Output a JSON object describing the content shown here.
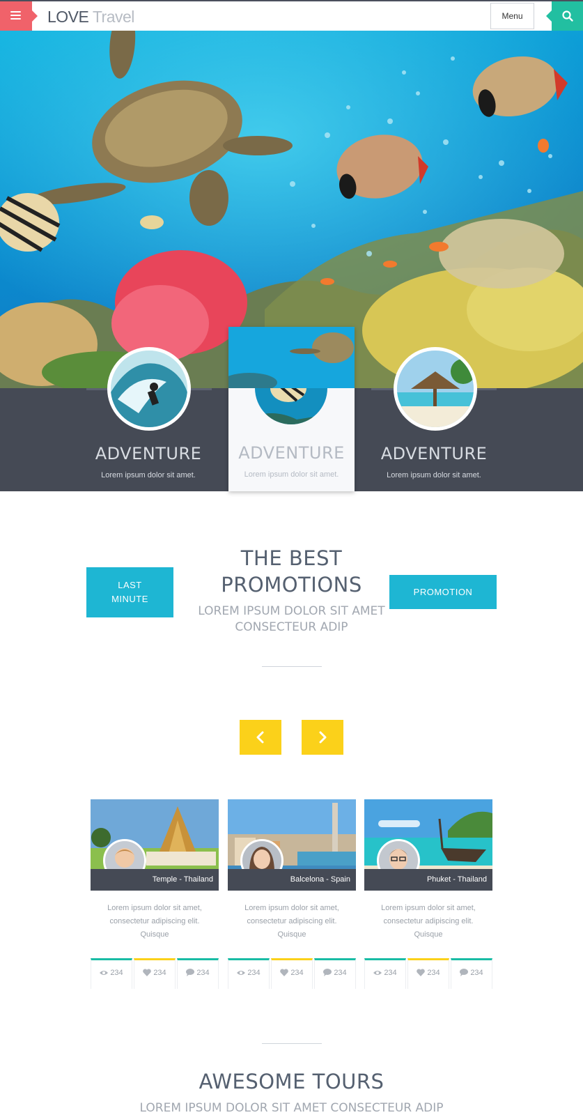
{
  "header": {
    "logo_part1": "LOVE",
    "logo_part2": "Travel",
    "menu_button": "Menu"
  },
  "categories": [
    {
      "title": "ADVENTURE",
      "subtitle": "Lorem ipsum dolor sit amet."
    },
    {
      "title": "ADVENTURE",
      "subtitle": "Lorem ipsum dolor sit amet."
    },
    {
      "title": "ADVENTURE",
      "subtitle": "Lorem ipsum dolor sit amet."
    }
  ],
  "promotions": {
    "title_line1": "THE BEST",
    "title_line2": "PROMOTIONS",
    "subtitle_line1": "LOREM IPSUM DOLOR SIT AMET",
    "subtitle_line2": "CONSECTEUR ADIP",
    "last_minute_line1": "LAST",
    "last_minute_line2": "MINUTE",
    "promotion_button": "PROMOTION"
  },
  "cards": [
    {
      "caption": "Temple - Thailand",
      "text": "Lorem ipsum dolor sit amet, consectetur adipiscing elit. Quisque",
      "views": "234",
      "likes": "234",
      "comments": "234"
    },
    {
      "caption": "Balcelona - Spain",
      "text": "Lorem ipsum dolor sit amet, consectetur adipiscing elit. Quisque",
      "views": "234",
      "likes": "234",
      "comments": "234"
    },
    {
      "caption": "Phuket - Thailand",
      "text": "Lorem ipsum dolor sit amet, consectetur adipiscing elit. Quisque",
      "views": "234",
      "likes": "234",
      "comments": "234"
    }
  ],
  "tours": {
    "title": "AWESOME TOURS",
    "subtitle": "LOREM IPSUM DOLOR SIT AMET CONSECTEUR ADIP"
  },
  "colors": {
    "accent_red": "#f0626a",
    "accent_green": "#22bfa1",
    "accent_cyan": "#1eb6d3",
    "accent_yellow": "#fbd11a",
    "dark_band": "#454a55"
  }
}
